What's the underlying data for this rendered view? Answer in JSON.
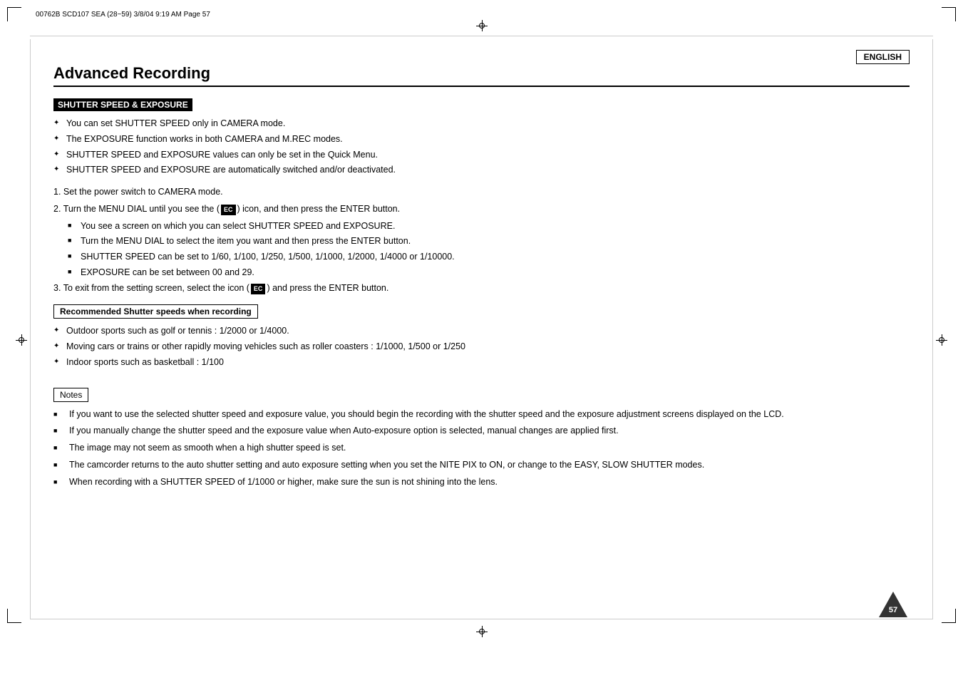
{
  "meta": {
    "file_info": "00762B SCD107 SEA (28~59)   3/8/04 9:19 AM   Page 57",
    "english_label": "ENGLISH",
    "page_number": "57"
  },
  "title": "Advanced Recording",
  "section1": {
    "heading": "SHUTTER SPEED & EXPOSURE",
    "bullets": [
      "You can set SHUTTER SPEED only in CAMERA mode.",
      "The EXPOSURE function works in both CAMERA and M.REC modes.",
      "SHUTTER SPEED and EXPOSURE values can only be set in the Quick Menu.",
      "SHUTTER SPEED and EXPOSURE are automatically switched and/or deactivated."
    ],
    "steps": [
      {
        "num": "1.",
        "text": "Set the power switch to CAMERA mode."
      },
      {
        "num": "2.",
        "text": "Turn the MENU DIAL until you see the (",
        "icon": "EC",
        "text2": ") icon, and then press the ENTER button.",
        "subbullets": [
          "You see a screen on which you can select SHUTTER SPEED and EXPOSURE.",
          "Turn the MENU DIAL to select the item you want and then press the ENTER button.",
          "SHUTTER SPEED can be set to 1/60, 1/100, 1/250, 1/500, 1/1000, 1/2000, 1/4000 or 1/10000.",
          "EXPOSURE can be set between 00 and 29."
        ]
      },
      {
        "num": "3.",
        "text": "To exit from the setting screen, select the icon (",
        "icon": "EC",
        "text2": ") and press the ENTER button."
      }
    ]
  },
  "section2": {
    "heading": "Recommended Shutter speeds when recording",
    "bullets": [
      "Outdoor sports such as golf or tennis : 1/2000 or 1/4000.",
      "Moving cars or trains or other rapidly moving vehicles such as roller coasters : 1/1000, 1/500 or 1/250",
      "Indoor sports such as basketball : 1/100"
    ]
  },
  "notes": {
    "label": "Notes",
    "items": [
      "If you want to use the selected shutter speed and exposure value, you should begin the recording with the shutter speed and the exposure adjustment screens displayed on the LCD.",
      "If you manually change the shutter speed and the exposure value when Auto-exposure option is selected, manual changes are applied first.",
      "The image may not seem as smooth when a high shutter speed is set.",
      "The camcorder returns to the auto shutter setting and auto exposure setting when you set the NITE PIX to ON, or change to the EASY, SLOW SHUTTER modes.",
      "When recording with a SHUTTER SPEED of 1/1000 or higher, make sure the sun is not shining into the lens."
    ]
  }
}
